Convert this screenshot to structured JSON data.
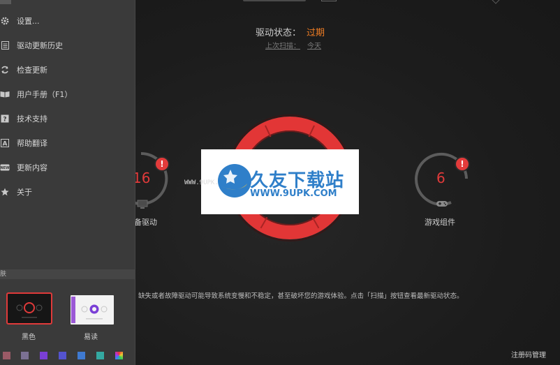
{
  "main": {
    "driver_status": {
      "label": "驱动状态：",
      "value": "过期"
    },
    "last_scan": {
      "label": "上次扫描：",
      "value": "今天"
    },
    "gauges": {
      "left": {
        "count": "16",
        "badge": "!",
        "label": "备驱动"
      },
      "right": {
        "count": "6",
        "badge": "!",
        "label": "游戏组件"
      }
    },
    "description": "缺失或者故障驱动可能导致系统变慢和不稳定，甚至破坏您的游戏体验。点击「扫描」按钮查看最新驱动状态。",
    "register_link": "注册码管理"
  },
  "watermark": {
    "title": "久友下载站",
    "url": "WWW.9UPK.COM",
    "url_left": "WWW.9UPK.COM"
  },
  "menu": {
    "items": [
      {
        "icon": "gear-icon",
        "label": "设置..."
      },
      {
        "icon": "history-icon",
        "label": "驱动更新历史"
      },
      {
        "icon": "refresh-icon",
        "label": "检查更新"
      },
      {
        "icon": "book-icon",
        "label": "用户手册（F1）"
      },
      {
        "icon": "question-icon",
        "label": "技术支持"
      },
      {
        "icon": "translate-icon",
        "label": "帮助翻译"
      },
      {
        "icon": "news-icon",
        "label": "更新内容"
      },
      {
        "icon": "star-icon",
        "label": "关于"
      }
    ],
    "skin_section": "肤",
    "skins": [
      {
        "name": "黑色",
        "selected": true
      },
      {
        "name": "易读",
        "selected": false
      }
    ],
    "swatches": [
      "#9a5a66",
      "#7b7193",
      "#7a3fd6",
      "#5453cf",
      "#3f7ad1",
      "#34a9a2",
      "rainbow"
    ]
  }
}
